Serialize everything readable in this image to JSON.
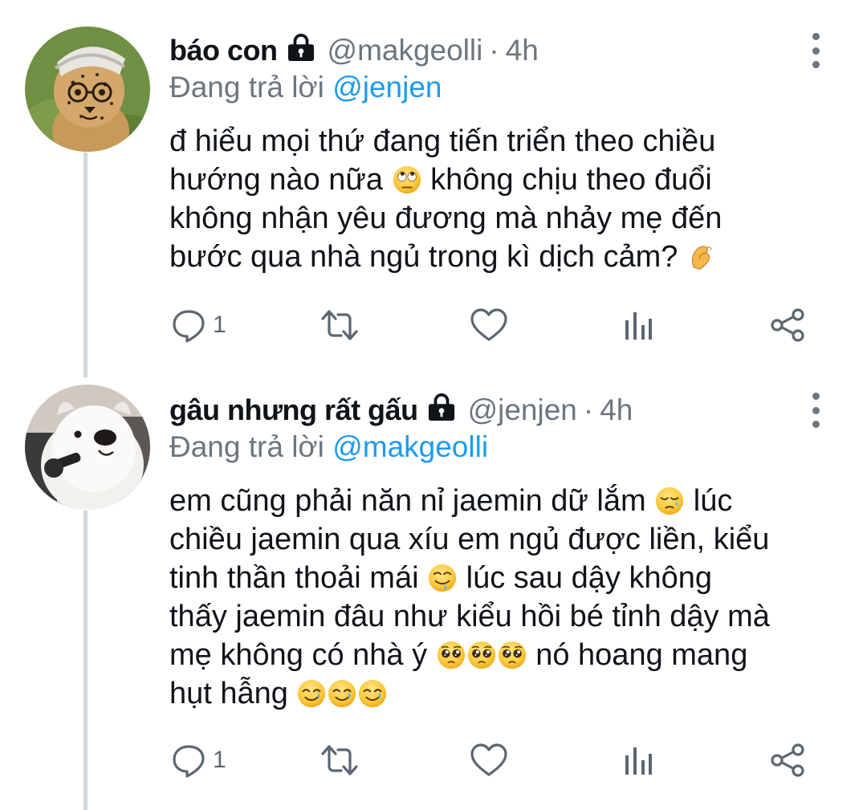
{
  "tweets": [
    {
      "name": "báo con",
      "handle": "@makgeolli",
      "dot": "·",
      "time": "4h",
      "replying_prefix": "Đang trả lời ",
      "replying_to": "@jenjen",
      "lines": [
        "đ hiểu mọi thứ đang tiến triển theo chiều",
        "hướng nào nữa",
        "không chịu theo đuổi",
        "không nhận yêu đương mà nhảy mẹ đến",
        "bước qua nhà ngủ trong kì dịch cảm?"
      ],
      "reply_count": "1"
    },
    {
      "name": "gâu nhưng rất gấu",
      "handle": "@jenjen",
      "dot": "·",
      "time": "4h",
      "replying_prefix": "Đang trả lời ",
      "replying_to": "@makgeolli",
      "lines": [
        "em cũng phải năn nỉ jaemin dữ lắm",
        "lúc",
        "chiều jaemin qua xíu em ngủ được liền, kiểu",
        "tinh thần thoải mái",
        "lúc sau dậy không",
        "thấy jaemin đâu như kiểu hồi bé tỉnh dậy mà",
        "mẹ không có nhà ý",
        "nó hoang mang",
        "hụt hẫng"
      ],
      "reply_count": "1"
    }
  ],
  "icons": [
    "lock-icon",
    "more-icon",
    "reply-icon",
    "retweet-icon",
    "like-icon",
    "analytics-icon",
    "share-icon",
    "eye-roll-emoji",
    "pinching-hand-emoji",
    "sleepy-face-emoji",
    "drooling-face-emoji",
    "pleading-face-emoji",
    "smiling-face-with-tear-emoji"
  ],
  "colors": {
    "link": "#1d9bf0",
    "secondary": "#6b7680",
    "thread_line": "#cfd9de",
    "text": "#0f1419"
  }
}
